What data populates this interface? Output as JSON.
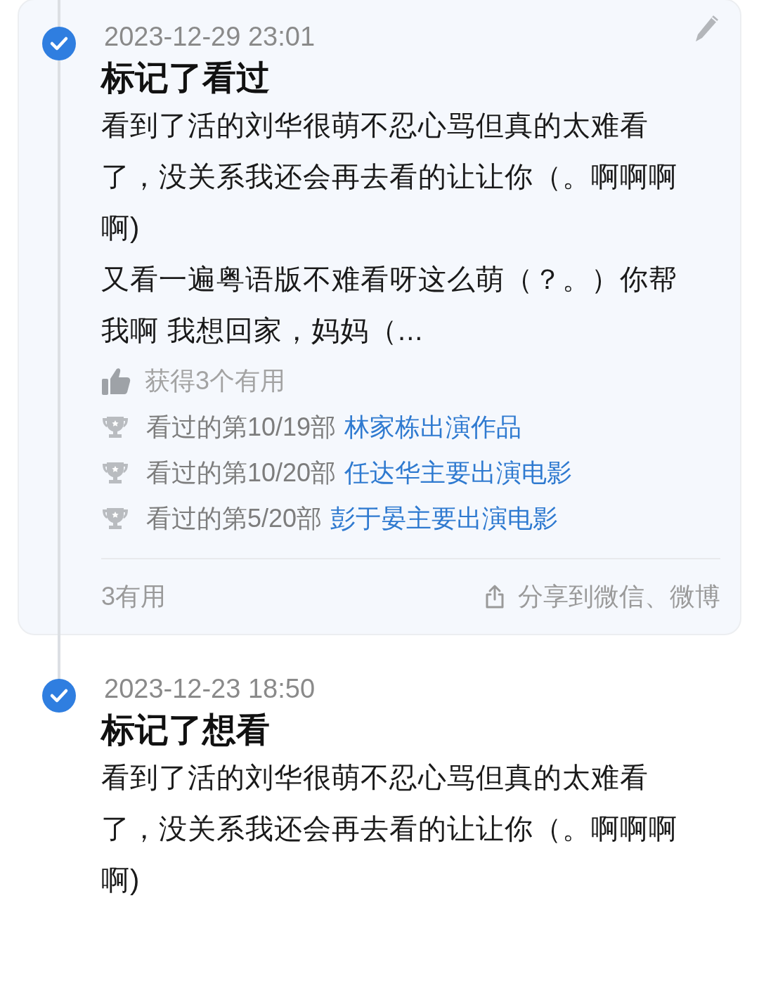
{
  "entries": [
    {
      "kind": "card",
      "date": "2023-12-29 23:01",
      "title": "标记了看过",
      "paragraphs": [
        "看到了活的刘华很萌不忍心骂但真的太难看了，没关系我还会再去看的让让你（。啊啊啊啊)",
        "又看一遍粤语版不难看呀这么萌（？。）你帮我啊 我想回家，妈妈（..."
      ],
      "likes": "获得3个有用",
      "achievements": [
        {
          "text": "看过的第10/19部",
          "link": "林家栋出演作品"
        },
        {
          "text": "看过的第10/20部",
          "link": "任达华主要出演电影"
        },
        {
          "text": "看过的第5/20部",
          "link": "彭于晏主要出演电影"
        }
      ],
      "useful": "3有用",
      "share": "分享到微信、微博"
    },
    {
      "kind": "plain",
      "date": "2023-12-23 18:50",
      "title": "标记了想看",
      "paragraphs": [
        "看到了活的刘华很萌不忍心骂但真的太难看了，没关系我还会再去看的让让你（。啊啊啊啊)"
      ]
    }
  ]
}
